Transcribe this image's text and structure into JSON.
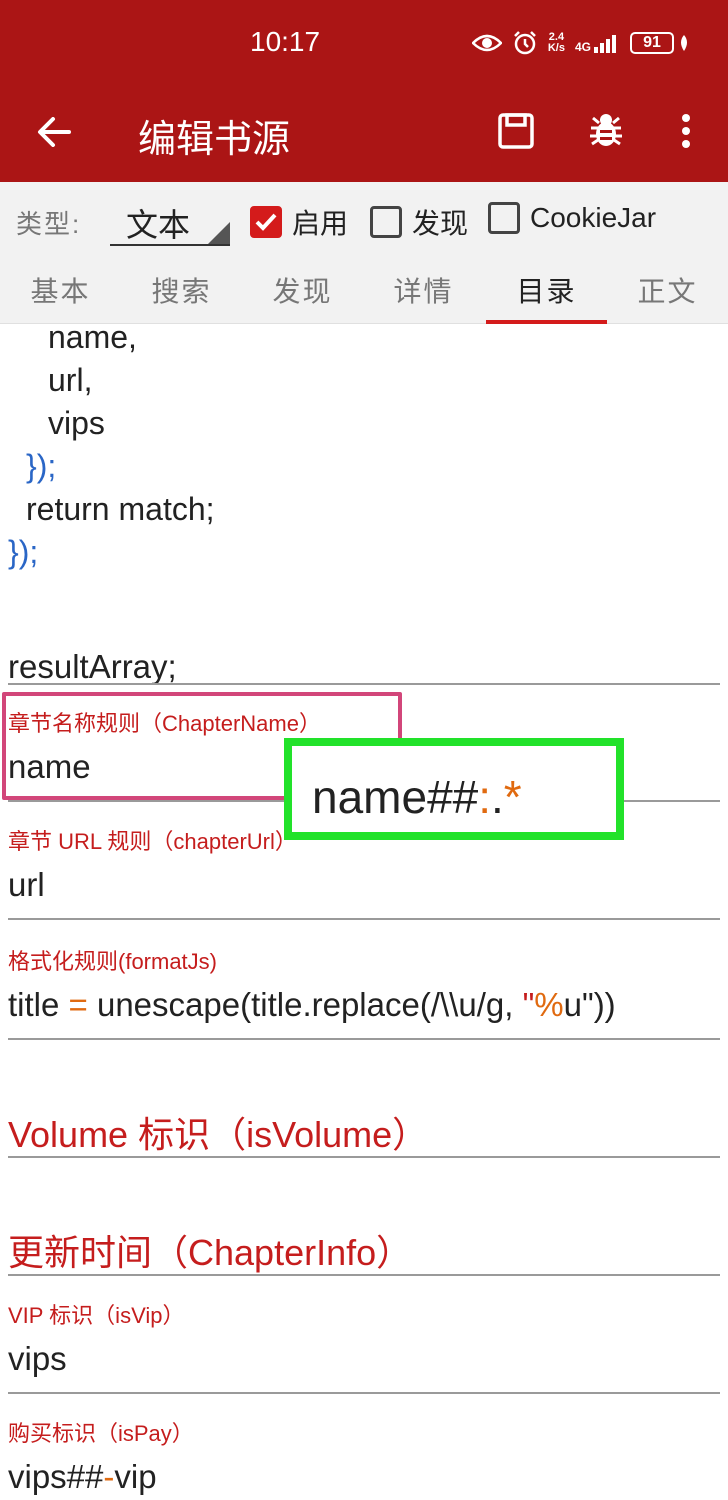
{
  "status_bar": {
    "time": "10:17",
    "net_speed_value": "2.4",
    "net_speed_unit": "K/s",
    "network": "4G",
    "battery": "91"
  },
  "app_bar": {
    "title": "编辑书源",
    "icons": [
      "back-arrow-icon",
      "save-icon",
      "bug-icon",
      "more-vert-icon"
    ]
  },
  "type_row": {
    "label": "类型:",
    "value": "文本",
    "checkboxes": [
      {
        "label": "启用",
        "checked": true
      },
      {
        "label": "发现",
        "checked": false
      },
      {
        "label": "CookieJar",
        "checked": false
      }
    ]
  },
  "tabs": [
    {
      "label": "基本"
    },
    {
      "label": "搜索"
    },
    {
      "label": "发现"
    },
    {
      "label": "详情"
    },
    {
      "label": "目录",
      "active": true
    },
    {
      "label": "正文"
    }
  ],
  "code": {
    "lines": [
      "name,",
      "url,",
      "vips",
      "});",
      "return match;",
      "});"
    ]
  },
  "fields": {
    "result_value": "resultArray;",
    "chapter_name": {
      "label": "章节名称规则（ChapterName）",
      "value": "name"
    },
    "chapter_url": {
      "label": "章节 URL 规则（chapterUrl）",
      "value": "url"
    },
    "format_js": {
      "label": "格式化规则(formatJs)",
      "value_parts": [
        "title ",
        "=",
        " unescape(title.replace(/\\\\u/g, ",
        "\"",
        "%",
        "u\"))"
      ]
    },
    "is_volume": {
      "label": "Volume 标识（isVolume）"
    },
    "chapter_info": {
      "label": "更新时间（ChapterInfo）"
    },
    "is_vip": {
      "label": "VIP 标识（isVip）",
      "value": "vips"
    },
    "is_pay": {
      "label": "购买标识（isPay）",
      "value_parts": [
        "vips##",
        "-",
        "vip"
      ]
    }
  },
  "annotation": {
    "text_parts": [
      "name##",
      ":",
      ".",
      "*"
    ],
    "pink_color": "#d2467a",
    "green_color": "#22e22a"
  },
  "colors": {
    "primary": "#ab1515",
    "accent": "#d41b1b",
    "label_red": "#c51d1d",
    "operator_orange": "#e06a10",
    "brace_blue": "#2a66c6"
  }
}
